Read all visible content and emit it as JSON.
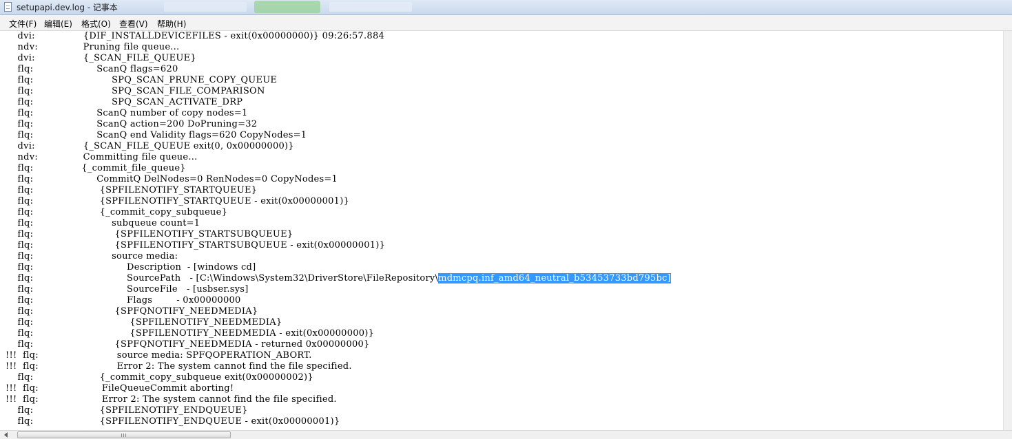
{
  "window": {
    "title": "setupapi.dev.log - 记事本"
  },
  "menu": [
    {
      "label": "文件(F)"
    },
    {
      "label": "编辑(E)"
    },
    {
      "label": "格式(O)"
    },
    {
      "label": "查看(V)"
    },
    {
      "label": "帮助(H)"
    }
  ],
  "editor": {
    "selection_color": "#3399ff",
    "lines": [
      "    dvi:                {DIF_INSTALLDEVICEFILES - exit(0x00000000)} 09:26:57.884",
      "    ndv:               Pruning file queue...",
      "    dvi:                {_SCAN_FILE_QUEUE}",
      "    flq:                     ScanQ flags=620",
      "    flq:                          SPQ_SCAN_PRUNE_COPY_QUEUE",
      "    flq:                          SPQ_SCAN_FILE_COMPARISON",
      "    flq:                          SPQ_SCAN_ACTIVATE_DRP",
      "    flq:                     ScanQ number of copy nodes=1",
      "    flq:                     ScanQ action=200 DoPruning=32",
      "    flq:                     ScanQ end Validity flags=620 CopyNodes=1",
      "    dvi:                {_SCAN_FILE_QUEUE exit(0, 0x00000000)}",
      "    ndv:               Committing file queue...",
      "    flq:                {_commit_file_queue}",
      "    flq:                     CommitQ DelNodes=0 RenNodes=0 CopyNodes=1",
      "    flq:                      {SPFILENOTIFY_STARTQUEUE}",
      "    flq:                      {SPFILENOTIFY_STARTQUEUE - exit(0x00000001)}",
      "    flq:                      {_commit_copy_subqueue}",
      "    flq:                          subqueue count=1",
      "    flq:                           {SPFILENOTIFY_STARTSUBQUEUE}",
      "    flq:                           {SPFILENOTIFY_STARTSUBQUEUE - exit(0x00000001)}",
      "    flq:                          source media:",
      "    flq:                               Description  - [windows cd]",
      "    flq:                               SourcePath   - [C:\\Windows\\System32\\DriverStore\\FileRepository\\",
      "    flq:                               SourceFile   - [usbser.sys]",
      "    flq:                               Flags        - 0x00000000",
      "    flq:                           {SPFQNOTIFY_NEEDMEDIA}",
      "    flq:                                {SPFILENOTIFY_NEEDMEDIA}",
      "    flq:                                {SPFILENOTIFY_NEEDMEDIA - exit(0x00000000)}",
      "    flq:                           {SPFQNOTIFY_NEEDMEDIA - returned 0x00000000}",
      "!!!  flq:                          source media: SPFQOPERATION_ABORT.",
      "!!!  flq:                          Error 2: The system cannot find the file specified.",
      "    flq:                      {_commit_copy_subqueue exit(0x00000002)}",
      "!!!  flq:                     FileQueueCommit aborting!",
      "!!!  flq:                     Error 2: The system cannot find the file specified.",
      "    flq:                      {SPFILENOTIFY_ENDQUEUE}",
      "    flq:                      {SPFILENOTIFY_ENDQUEUE - exit(0x00000001)}"
    ],
    "selected_text": "mdmcpq.inf_amd64_neutral_b53453733bd795bc]"
  }
}
